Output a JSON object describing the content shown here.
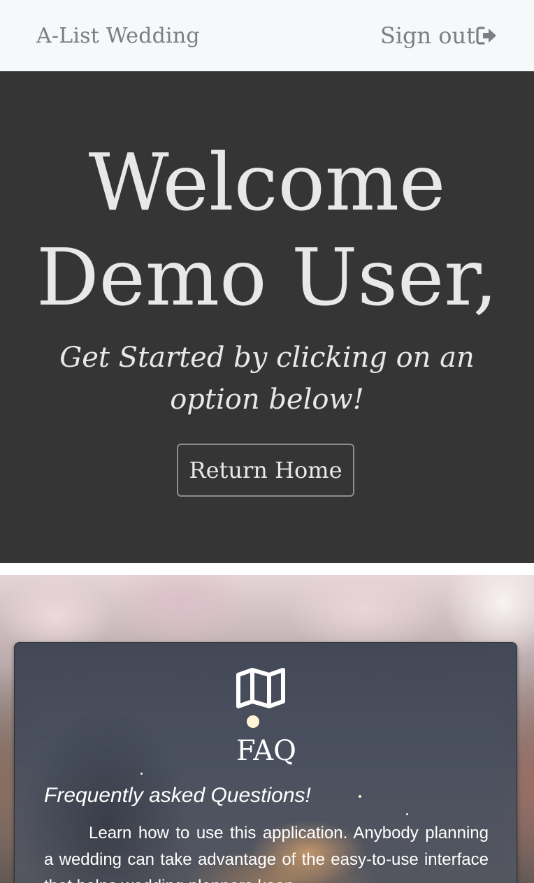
{
  "navbar": {
    "brand": "A-List Wedding",
    "signout_label": "Sign out",
    "signout_icon": "sign-out-icon"
  },
  "hero": {
    "title_line1": "Welcome",
    "title_line2": "Demo User,",
    "subtitle": "Get Started by clicking on an option below!",
    "button_label": "Return Home"
  },
  "faq_card": {
    "icon": "map-icon",
    "title": "FAQ",
    "subtitle": "Frequently asked Questions!",
    "body": "Learn how to use this application. Anybody planning a wedding can take advantage of the easy-to-use interface that helps wedding planners keep"
  },
  "colors": {
    "navbar_bg": "#f7f8fa",
    "navbar_text": "#7b7f85",
    "hero_bg": "#353535",
    "hero_text": "#e8e8e8",
    "card_text": "#ffffff"
  }
}
